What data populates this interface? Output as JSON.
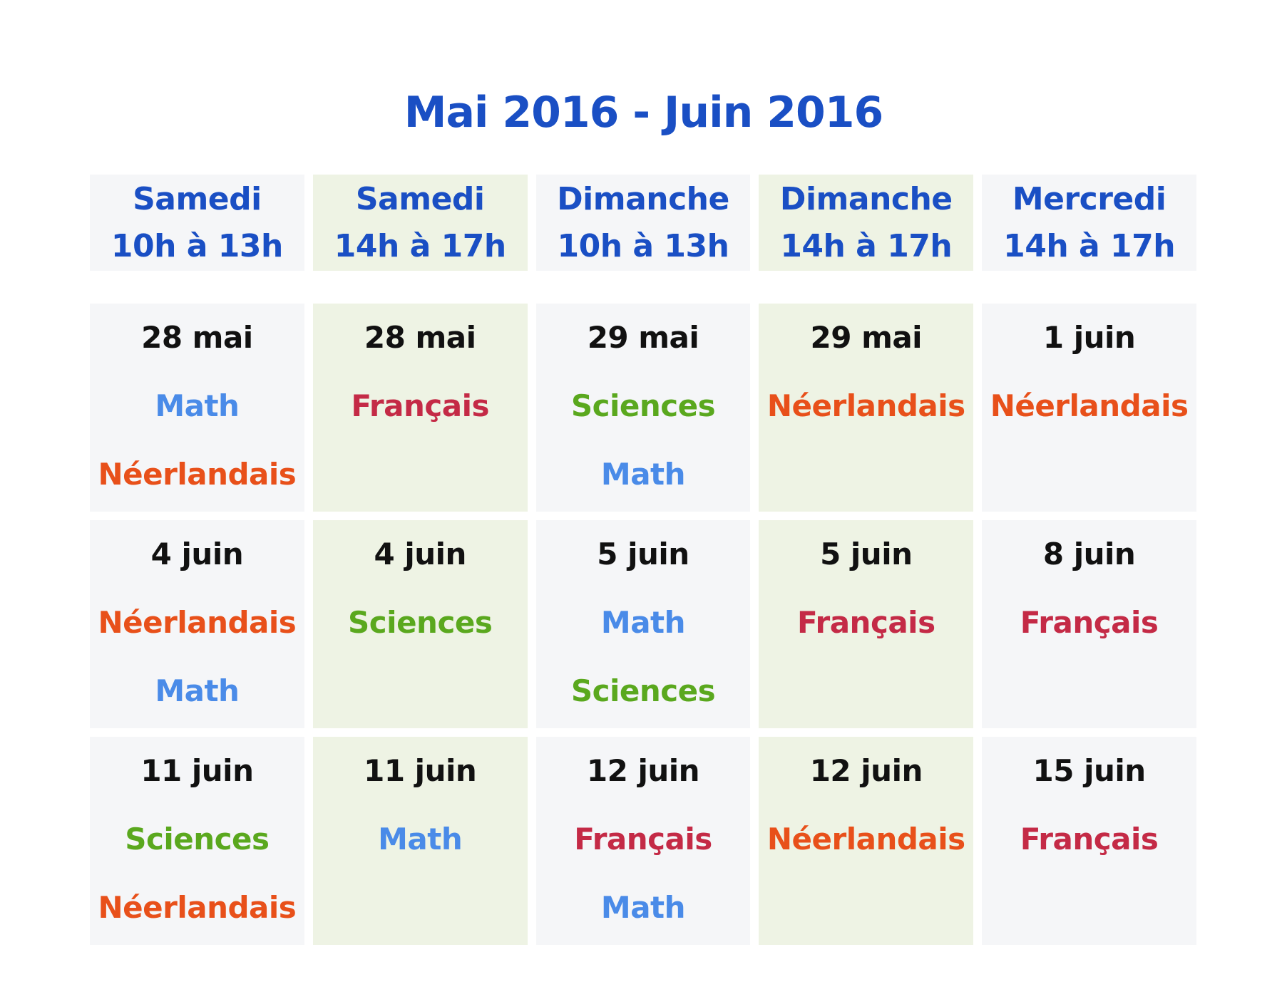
{
  "title": "Mai 2016 - Juin 2016",
  "colors": {
    "title": "#1a4fc4",
    "date": "#111111",
    "Math": "#4a8be8",
    "Néerlandais": "#e8501a",
    "Français": "#c42a46",
    "Sciences": "#5aa81e",
    "cell_light": "#f5f6f8",
    "cell_green": "#eef3e4"
  },
  "columns": [
    {
      "day": "Samedi",
      "time": "10h à 13h"
    },
    {
      "day": "Samedi",
      "time": "14h à 17h"
    },
    {
      "day": "Dimanche",
      "time": "10h à 13h"
    },
    {
      "day": "Dimanche",
      "time": "14h à 17h"
    },
    {
      "day": "Mercredi",
      "time": "14h à 17h"
    }
  ],
  "rows": [
    [
      {
        "date": "28 mai",
        "subjects": [
          "Math",
          "Néerlandais"
        ]
      },
      {
        "date": "28 mai",
        "subjects": [
          "Français"
        ]
      },
      {
        "date": "29 mai",
        "subjects": [
          "Sciences",
          "Math"
        ]
      },
      {
        "date": "29 mai",
        "subjects": [
          "Néerlandais"
        ]
      },
      {
        "date": "1 juin",
        "subjects": [
          "Néerlandais"
        ]
      }
    ],
    [
      {
        "date": "4 juin",
        "subjects": [
          "Néerlandais",
          "Math"
        ]
      },
      {
        "date": "4 juin",
        "subjects": [
          "Sciences"
        ]
      },
      {
        "date": "5 juin",
        "subjects": [
          "Math",
          "Sciences"
        ]
      },
      {
        "date": "5 juin",
        "subjects": [
          "Français"
        ]
      },
      {
        "date": "8 juin",
        "subjects": [
          "Français"
        ]
      }
    ],
    [
      {
        "date": "11 juin",
        "subjects": [
          "Sciences",
          "Néerlandais"
        ]
      },
      {
        "date": "11 juin",
        "subjects": [
          "Math"
        ]
      },
      {
        "date": "12 juin",
        "subjects": [
          "Français",
          "Math"
        ]
      },
      {
        "date": "12 juin",
        "subjects": [
          "Néerlandais"
        ]
      },
      {
        "date": "15 juin",
        "subjects": [
          "Français"
        ]
      }
    ]
  ]
}
